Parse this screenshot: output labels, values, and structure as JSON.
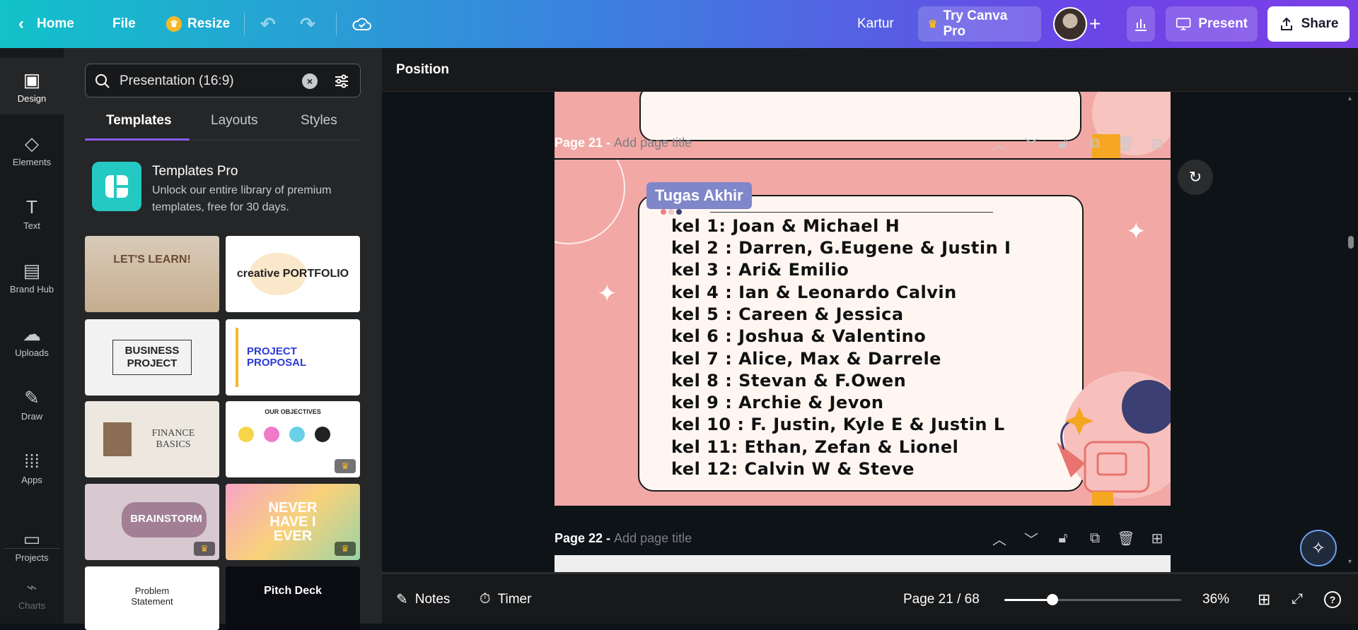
{
  "topbar": {
    "home_label": "Home",
    "file_label": "File",
    "resize_label": "Resize",
    "design_name": "Kartur",
    "try_pro_label": "Try Canva Pro",
    "present_label": "Present",
    "share_label": "Share"
  },
  "rail": {
    "items": [
      {
        "label": "Design",
        "icon": "layout-icon"
      },
      {
        "label": "Elements",
        "icon": "shapes-icon"
      },
      {
        "label": "Text",
        "icon": "text-icon"
      },
      {
        "label": "Brand Hub",
        "icon": "brand-icon"
      },
      {
        "label": "Uploads",
        "icon": "cloud-upload-icon"
      },
      {
        "label": "Draw",
        "icon": "pen-icon"
      },
      {
        "label": "Apps",
        "icon": "apps-grid-icon"
      },
      {
        "label": "Projects",
        "icon": "folder-icon"
      },
      {
        "label": "Charts",
        "icon": "chart-icon"
      }
    ]
  },
  "panel": {
    "search_value": "Presentation (16:9)",
    "tabs": [
      "Templates",
      "Layouts",
      "Styles"
    ],
    "promo": {
      "title": "Templates Pro",
      "desc": "Unlock our entire library of premium templates, free for 30 days."
    },
    "templates": [
      {
        "title": "LET'S LEARN!"
      },
      {
        "title": "creative PORTFOLIO"
      },
      {
        "title": "BUSINESS PROJECT"
      },
      {
        "title": "PROJECT PROPOSAL"
      },
      {
        "title": "FINANCE BASICS"
      },
      {
        "title": "OUR OBJECTIVES"
      },
      {
        "title": "BRAINSTORM"
      },
      {
        "title": "NEVER HAVE I EVER"
      },
      {
        "title": "Problem Statement"
      },
      {
        "title": "Pitch Deck"
      }
    ]
  },
  "canvas": {
    "position_label": "Position",
    "page21": {
      "label": "Page 21 - ",
      "placeholder": "Add page title"
    },
    "page22": {
      "label": "Page 22 - ",
      "placeholder": "Add page title"
    },
    "slide": {
      "tag": "Tugas Akhir",
      "lines": [
        "kel 1:  Joan & Michael H",
        "kel 2 : Darren, G.Eugene & Justin I",
        "kel 3 : Ari& Emilio",
        "kel 4 : Ian & Leonardo Calvin",
        "kel 5 : Careen & Jessica",
        "kel 6 : Joshua & Valentino",
        "kel 7 : Alice, Max & Darrele",
        "kel 8 : Stevan & F.Owen",
        "kel 9 : Archie & Jevon",
        "kel 10 : F. Justin, Kyle E & Justin L",
        "kel 11: Ethan, Zefan & Lionel",
        "kel 12: Calvin W & Steve"
      ]
    }
  },
  "bottombar": {
    "notes_label": "Notes",
    "timer_label": "Timer",
    "page_indicator": "Page 21 / 68",
    "zoom_label": "36%",
    "zoom_fraction": 0.27
  },
  "colors": {
    "accent": "#8b5cf6",
    "slide_bg": "#f2a8a5",
    "tag_bg": "#7f86c9",
    "pro_gold": "#f7b928"
  }
}
